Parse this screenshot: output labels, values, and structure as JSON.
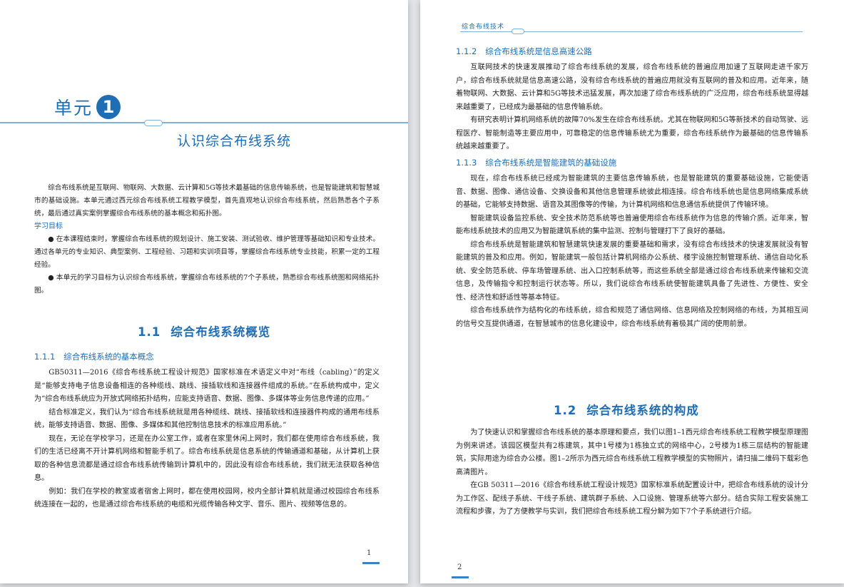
{
  "left_page": {
    "unit_label": "单元",
    "unit_number": "1",
    "unit_title": "认识综合布线系统",
    "intro": "综合布线系统是互联网、物联网、大数据、云计算和5G等技术最基础的信息传输系统，也是智能建筑和智慧城市的基础设施。本单元通过西元综合布线系统工程教学模型，首先直观地认识综合布线系统，然后熟悉各个子系统，最后通过真实案例掌握综合布线系统的基本概念和拓扑图。",
    "goals_heading": "学习目标",
    "goals": [
      "● 在本课程结束时，掌握综合布线系统的规划设计、施工安装、测试验收、维护管理等基础知识和专业技术。通过各单元的专业知识、典型案例、工程经验、习题和实训项目等，掌握综合布线系统专业技能，积累一定的工程经验。",
      "● 本单元的学习目标为认识综合布线系统，掌握综合布线系统的7个子系统，熟悉综合布线系统图和网络拓扑图。"
    ],
    "section_number": "1.1",
    "section_title": "综合布线系统概览",
    "subsection_number": "1.1.1",
    "subsection_title": "综合布线系统的基本概念",
    "paragraphs": [
      "GB50311—2016《综合布线系统工程设计规范》国家标准在术语定义中对“布线（cabling）”的定义是“能够支持电子信息设备相连的各种缆线、跳线、接插软线和连接器件组成的系统。”在系统构成中，定义为“综合布线系统应为开放式网络拓扑结构，应能支持语音、数据、图像、多媒体等业务信息传递的应用。”",
      "结合标准定义，我们认为“综合布线系统就是用各种缆线、跳线、接插软线和连接器件构成的通用布线系统，能够支持语音、数据、图像、多媒体和其他控制信息技术的标准应用系统。”",
      "现在，无论在学校学习，还是在办公室工作，或者在家里休闲上网时，我们都在使用综合布线系统，我们的生活已经离不开计算机网络和智能手机了。综合布线系统是信息系统的传输通道和基础，从计算机上获取的各种信息流都是通过综合布线系统传输到计算机中的，因此没有综合布线系统，我们就无法获取各种信息。",
      "例如：我们在学校的教室或者宿舍上网时，都在使用校园网，校内全部计算机就是通过校园综合布线系统连接在一起的，也是通过综合布线系统的电缆和光缆传输各种文字、音乐、图片、视频等信息的。"
    ],
    "page_number": "1"
  },
  "right_page": {
    "running_head": "综合布线技术",
    "sub1_number": "1.1.2",
    "sub1_title": "综合布线系统是信息高速公路",
    "sub1_paragraphs": [
      "互联网技术的快速发展推动了综合布线系统的发展，综合布线系统的普遍应用加速了互联网走进千家万户，综合布线系统就是信息高速公路，没有综合布线系统的普遍应用就没有互联网的普及和应用。近年来，随着物联网、大数据、云计算和5G等技术迅猛发展，再次加速了综合布线系统的广泛应用，综合布线系统显得越来越重要了，已经成为最基础的信息传输系统。",
      "有研究表明计算机网络系统的故障70%发生在综合布线系统。尤其在物联网和5G等新技术的自动驾驶、远程医疗、智能制造等主要应用中，可靠稳定的信息传输系统尤为重要，综合布线系统作为最基础的信息传输系统越来越重要了。"
    ],
    "sub2_number": "1.1.3",
    "sub2_title": "综合布线系统是智能建筑的基础设施",
    "sub2_paragraphs": [
      "现在，综合布线系统已经成为智能建筑的主要信息传输系统，也是智能建筑的重要基础设施，它能使语音、数据、图像、通信设备、交换设备和其他信息管理系统彼此相连接。综合布线系统也是信息网络集成系统的基础，它能够支持数据、语音及其图像等的传输，为计算机网络和信息通信系统提供了传输环境。",
      "智能建筑设备监控系统、安全技术防范系统等也普遍使用综合布线系统作为信息的传输介质。近年来，智能布线系统技术的应用又为智能建筑系统的集中监测、控制与管理打下了良好的基础。",
      "综合布线系统是智能建筑和智慧建筑快速发展的重要基础和需求，没有综合布线技术的快速发展就没有智能建筑的普及和应用。例如，智能建筑一般包括计算机网络办公系统、楼宇设施控制管理系统、通信自动化系统、安全防范系统、停车场管理系统、出入口控制系统等，而这些系统全部是通过综合布线系统来传输和交流信息，及传输指令和控制运行状态等。所以，我们说综合布线系统使智能建筑具备了先进性、方便性、安全性、经济性和舒适性等基本特征。",
      "综合布线系统作为结构化的布线系统，综合和规范了通信网络、信息网络及控制网络的布线，为其相互间的信号交互提供通道，在智慧城市的信息化建设中，综合布线系统有着极其广阔的使用前景。"
    ],
    "section_number": "1.2",
    "section_title": "综合布线系统的构成",
    "sec2_paragraphs": [
      "为了快速认识和掌握综合布线系统的基本原理和要点，我们以图1–1西元综合布线系统工程教学模型原理图为例来讲述。该园区模型共有2栋建筑，其中1号楼为1栋独立式的网络中心，2号楼为1栋三层结构的智能建筑，实际用途为综合办公楼。图1–2所示为西元综合布线系统工程教学模型的实物照片，请扫描二维码下载彩色高清图片。",
      "在GB 50311—2016《综合布线系统工程设计规范》国家标准系统配置设计中，把综合布线系统的设计分为工作区、配线子系统、干线子系统、建筑群子系统、入口设施、管理系统等六部分。结合实际工程安装施工流程和步骤，为了方便教学与实训，我们把综合布线系统工程分解为如下7个子系统进行介绍。"
    ],
    "page_number": "2"
  }
}
